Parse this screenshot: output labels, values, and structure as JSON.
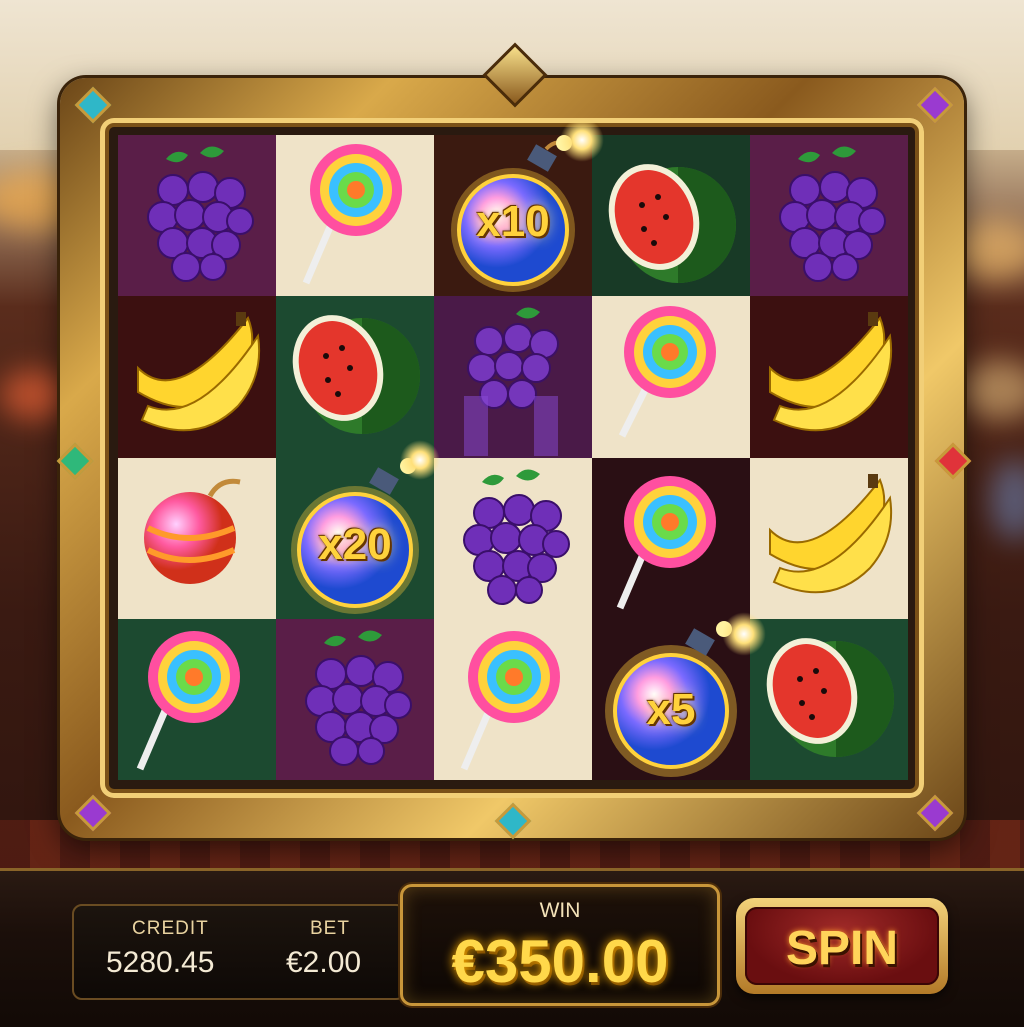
{
  "game": {
    "credit_label": "CREDIT",
    "credit_value": "5280.45",
    "bet_label": "BET",
    "bet_value": "€2.00",
    "win_label": "WIN",
    "win_value": "€350.00",
    "spin_label": "SPIN"
  },
  "reels": [
    [
      "grapes-icon",
      "lollipop-icon",
      "bomb-icon",
      "watermelon-icon",
      "grapes-icon"
    ],
    [
      "banana-icon",
      "watermelon-icon",
      "grapes-icon",
      "lollipop-icon",
      "banana-icon"
    ],
    [
      "cherry-bomb-icon",
      "bomb-icon",
      "grapes-icon",
      "lollipop-icon",
      "banana-icon"
    ],
    [
      "lollipop-icon",
      "grapes-icon",
      "lollipop-icon",
      "bomb-icon",
      "watermelon-icon"
    ]
  ],
  "multipliers": {
    "row0_col2": "x10",
    "row2_col1": "x20",
    "row3_col3": "x5"
  },
  "colors": {
    "accent_gold": "#ffd23c",
    "spin_red": "#8a1418"
  }
}
